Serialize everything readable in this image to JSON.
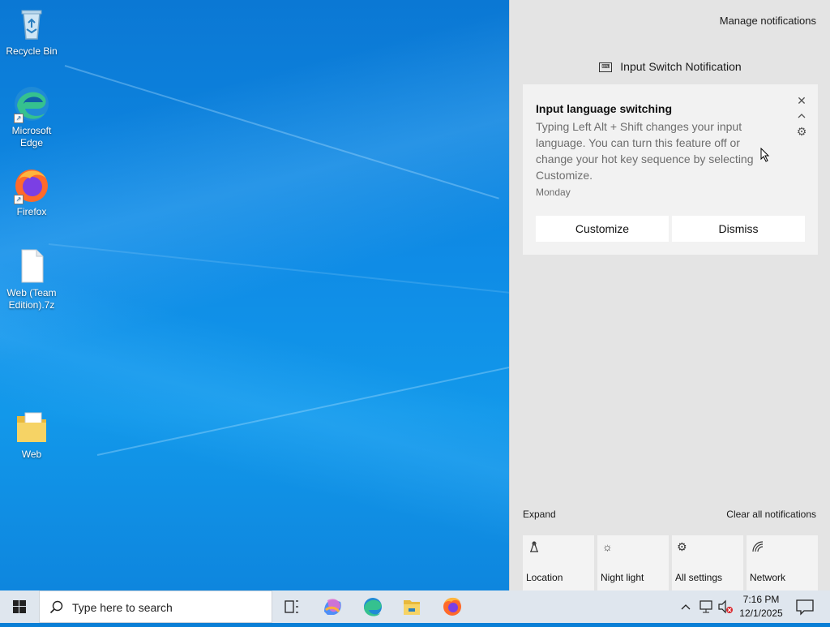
{
  "desktop": {
    "icons": [
      {
        "label": "Recycle Bin",
        "icon": "recycle-bin-icon"
      },
      {
        "label": "Microsoft Edge",
        "icon": "edge-icon"
      },
      {
        "label": "Firefox",
        "icon": "firefox-icon"
      },
      {
        "label": "Web (Team Edition).7z",
        "icon": "file-icon"
      },
      {
        "label": "Web",
        "icon": "folder-icon"
      }
    ]
  },
  "action_center": {
    "manage_notifications": "Manage notifications",
    "group_title": "Input Switch Notification",
    "toast": {
      "title": "Input language switching",
      "body": "Typing Left Alt + Shift changes your input language. You can turn this feature off or change your hot key sequence by selecting Customize.",
      "time": "Monday",
      "customize_label": "Customize",
      "dismiss_label": "Dismiss"
    },
    "expand_label": "Expand",
    "clear_all_label": "Clear all notifications",
    "quick_actions": [
      {
        "label": "Location",
        "icon": "location-icon"
      },
      {
        "label": "Night light",
        "icon": "night-light-icon"
      },
      {
        "label": "All settings",
        "icon": "settings-icon"
      },
      {
        "label": "Network",
        "icon": "network-icon"
      }
    ]
  },
  "taskbar": {
    "search_placeholder": "Type here to search",
    "apps": [
      "task-view-icon",
      "copilot-icon",
      "edge-icon",
      "file-explorer-icon",
      "firefox-icon"
    ],
    "clock": {
      "time": "7:16 PM",
      "date": "12/1/2025"
    }
  },
  "colors": {
    "wallpaper": "#0b78d4",
    "panel": "#e4e4e4",
    "taskbar": "#dfe6ee",
    "accent": "#0078d4"
  }
}
